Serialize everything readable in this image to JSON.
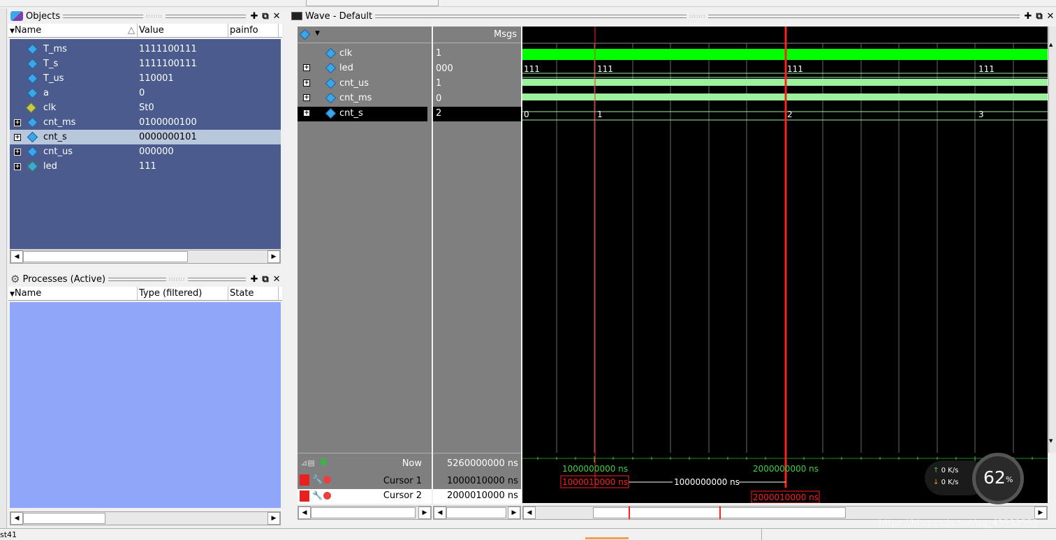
{
  "objects_panel": {
    "title": "Objects",
    "columns": {
      "name": "Name",
      "value": "Value",
      "painfo": "painfo"
    },
    "rows": [
      {
        "name": "T_ms",
        "value": "1111100111"
      },
      {
        "name": "T_s",
        "value": "1111100111"
      },
      {
        "name": "T_us",
        "value": "110001"
      },
      {
        "name": "a",
        "value": "0"
      },
      {
        "name": "clk",
        "value": "St0"
      },
      {
        "name": "cnt_ms",
        "value": "0100000100"
      },
      {
        "name": "cnt_s",
        "value": "0000000101"
      },
      {
        "name": "cnt_us",
        "value": "000000"
      },
      {
        "name": "led",
        "value": "111"
      }
    ]
  },
  "processes_panel": {
    "title": "Processes (Active)",
    "columns": {
      "name": "Name",
      "type": "Type (filtered)",
      "state": "State"
    }
  },
  "wave_panel": {
    "title": "Wave - Default",
    "msgs_header": "Msgs",
    "signals": [
      {
        "name": "clk",
        "value": "1"
      },
      {
        "name": "led",
        "value": "000"
      },
      {
        "name": "cnt_us",
        "value": "1"
      },
      {
        "name": "cnt_ms",
        "value": "0"
      },
      {
        "name": "cnt_s",
        "value": "2"
      }
    ],
    "wave_labels": {
      "led": [
        "111",
        "111",
        "111",
        "111"
      ],
      "cnt_s": [
        "0",
        "1",
        "2",
        "3"
      ]
    },
    "footer": {
      "now_label": "Now",
      "now_value": "5260000000 ns",
      "cursor1_label": "Cursor 1",
      "cursor1_value": "1000010000 ns",
      "cursor2_label": "Cursor 2",
      "cursor2_value": "2000010000 ns"
    },
    "timeline": {
      "tick1": "1000000000 ns",
      "tick2": "2000000000 ns",
      "cursor1_box": "1000010000 ns",
      "delta": "1000000000 ns",
      "cursor2_box": "2000010000 ns"
    }
  },
  "net_widget": {
    "up": "0",
    "down": "0",
    "unit": "K/s",
    "percent": "62",
    "percent_sign": "%"
  },
  "watermark": "https://blog.csdn.net/qq_43533553",
  "status_fragment": "st41",
  "colors": {
    "objects_bg": "#4b5b8e",
    "processes_bg": "#8fa6fb",
    "wave_bg": "#000000",
    "msgs_bg": "#7f7f7f",
    "clk_green": "#00ff00",
    "bus_green": "#9cf29c",
    "cursor_red": "#ff0000"
  }
}
